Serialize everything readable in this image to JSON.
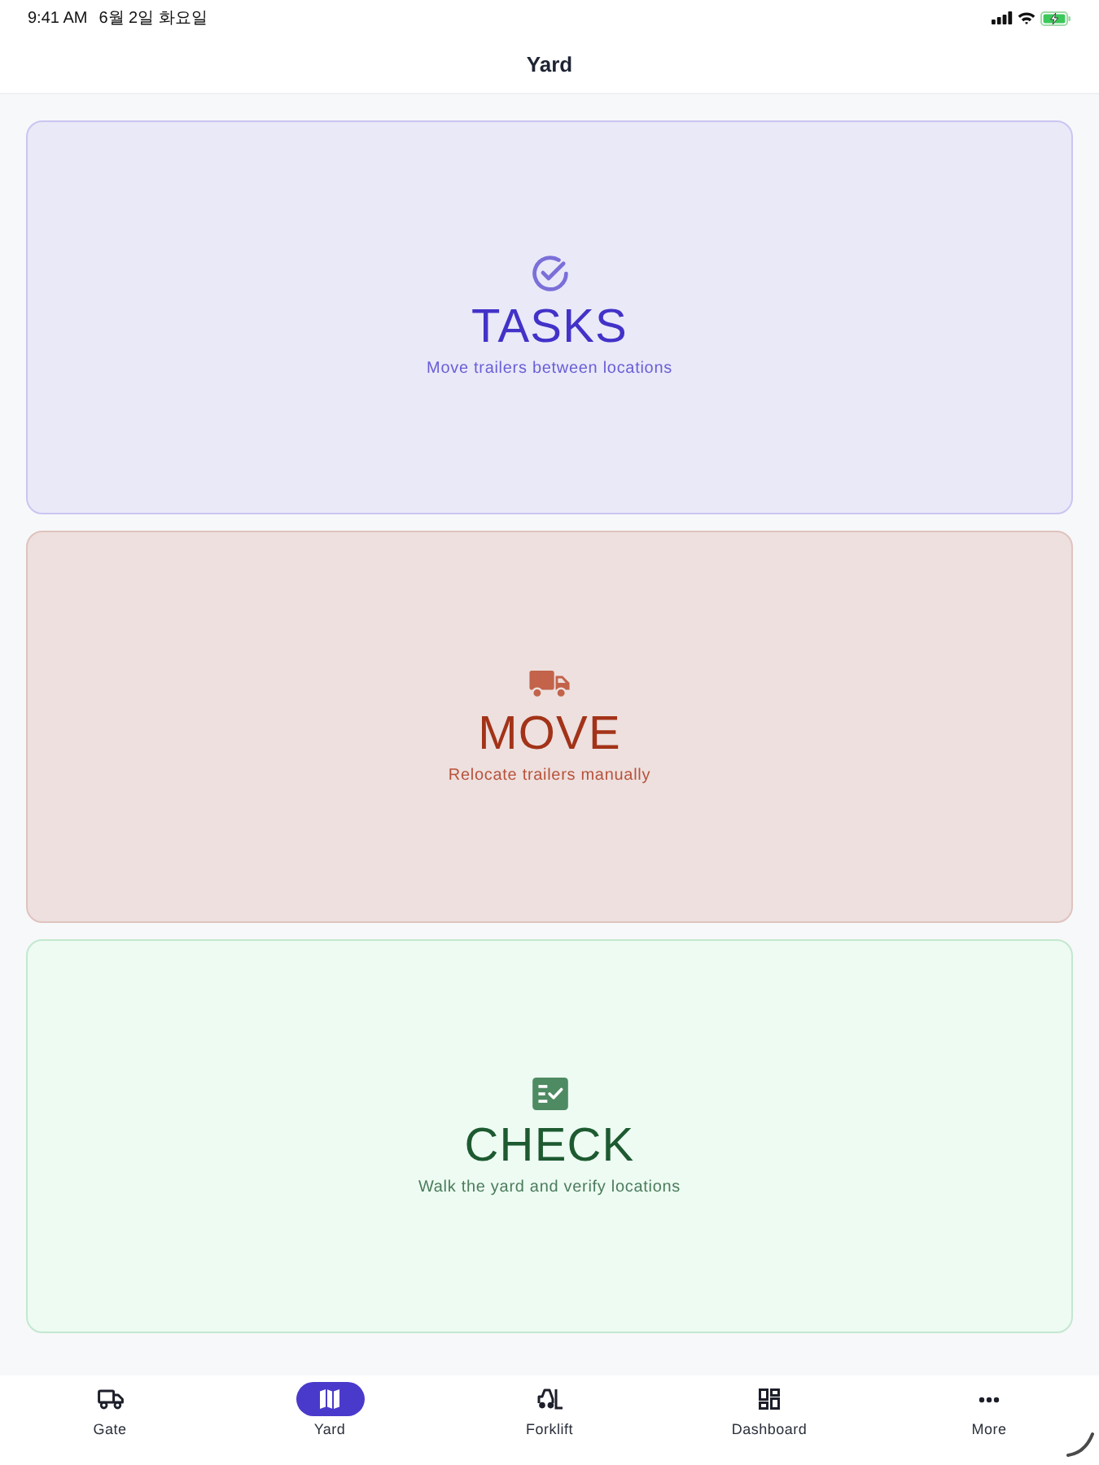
{
  "status_bar": {
    "time": "9:41 AM",
    "date": "6월 2일 화요일"
  },
  "header": {
    "title": "Yard"
  },
  "cards": [
    {
      "kind": "tasks",
      "title": "TASKS",
      "subtitle": "Move trailers between locations"
    },
    {
      "kind": "move",
      "title": "MOVE",
      "subtitle": "Relocate trailers manually"
    },
    {
      "kind": "check",
      "title": "CHECK",
      "subtitle": "Walk the yard and verify locations"
    }
  ],
  "tab_bar": {
    "tabs": [
      {
        "kind": "gate",
        "label": "Gate",
        "selected": false
      },
      {
        "kind": "yard",
        "label": "Yard",
        "selected": true
      },
      {
        "kind": "forklift",
        "label": "Forklift",
        "selected": false
      },
      {
        "kind": "dashboard",
        "label": "Dashboard",
        "selected": false
      },
      {
        "kind": "more",
        "label": "More",
        "selected": false
      }
    ]
  }
}
